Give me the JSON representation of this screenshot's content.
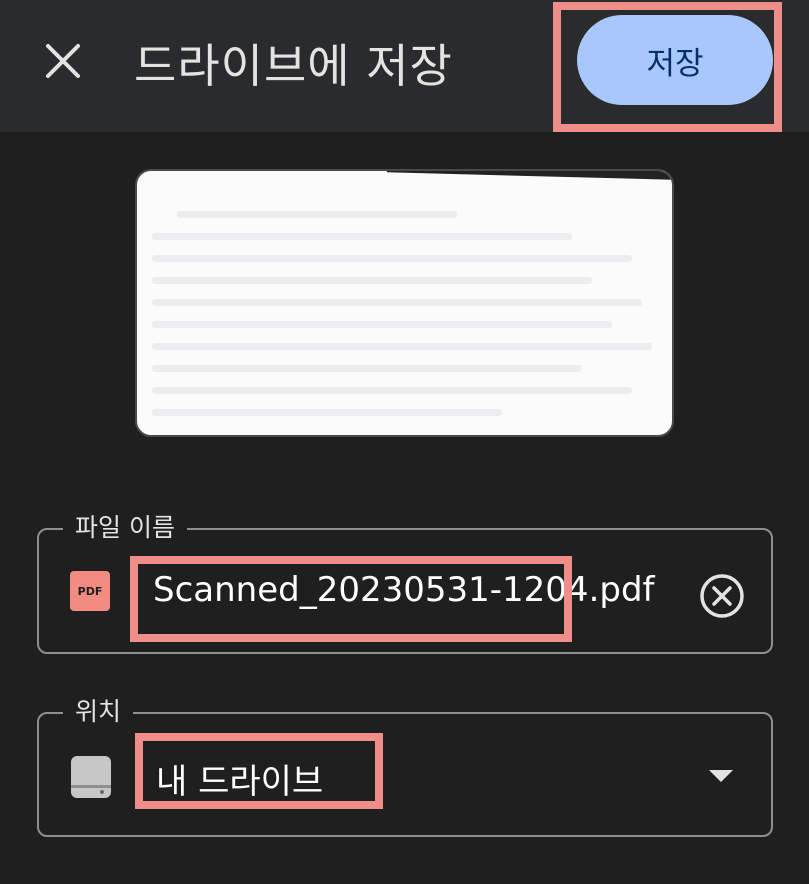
{
  "header": {
    "title": "드라이브에 저장",
    "save_label": "저장"
  },
  "file_name_field": {
    "label": "파일 이름",
    "value": "Scanned_20230531-1204",
    "extension": ".pdf",
    "file_type_icon": "PDF"
  },
  "location_field": {
    "label": "위치",
    "value": "내 드라이브"
  },
  "colors": {
    "header_bg": "#2a2b2d",
    "page_bg": "#1f1f1f",
    "save_button": "#a8c7fa",
    "highlight": "#ef8e88",
    "pdf_badge": "#f28b82"
  },
  "icons": [
    "close-icon",
    "pdf-file-icon",
    "clear-icon",
    "drive-icon",
    "dropdown-arrow-icon"
  ]
}
